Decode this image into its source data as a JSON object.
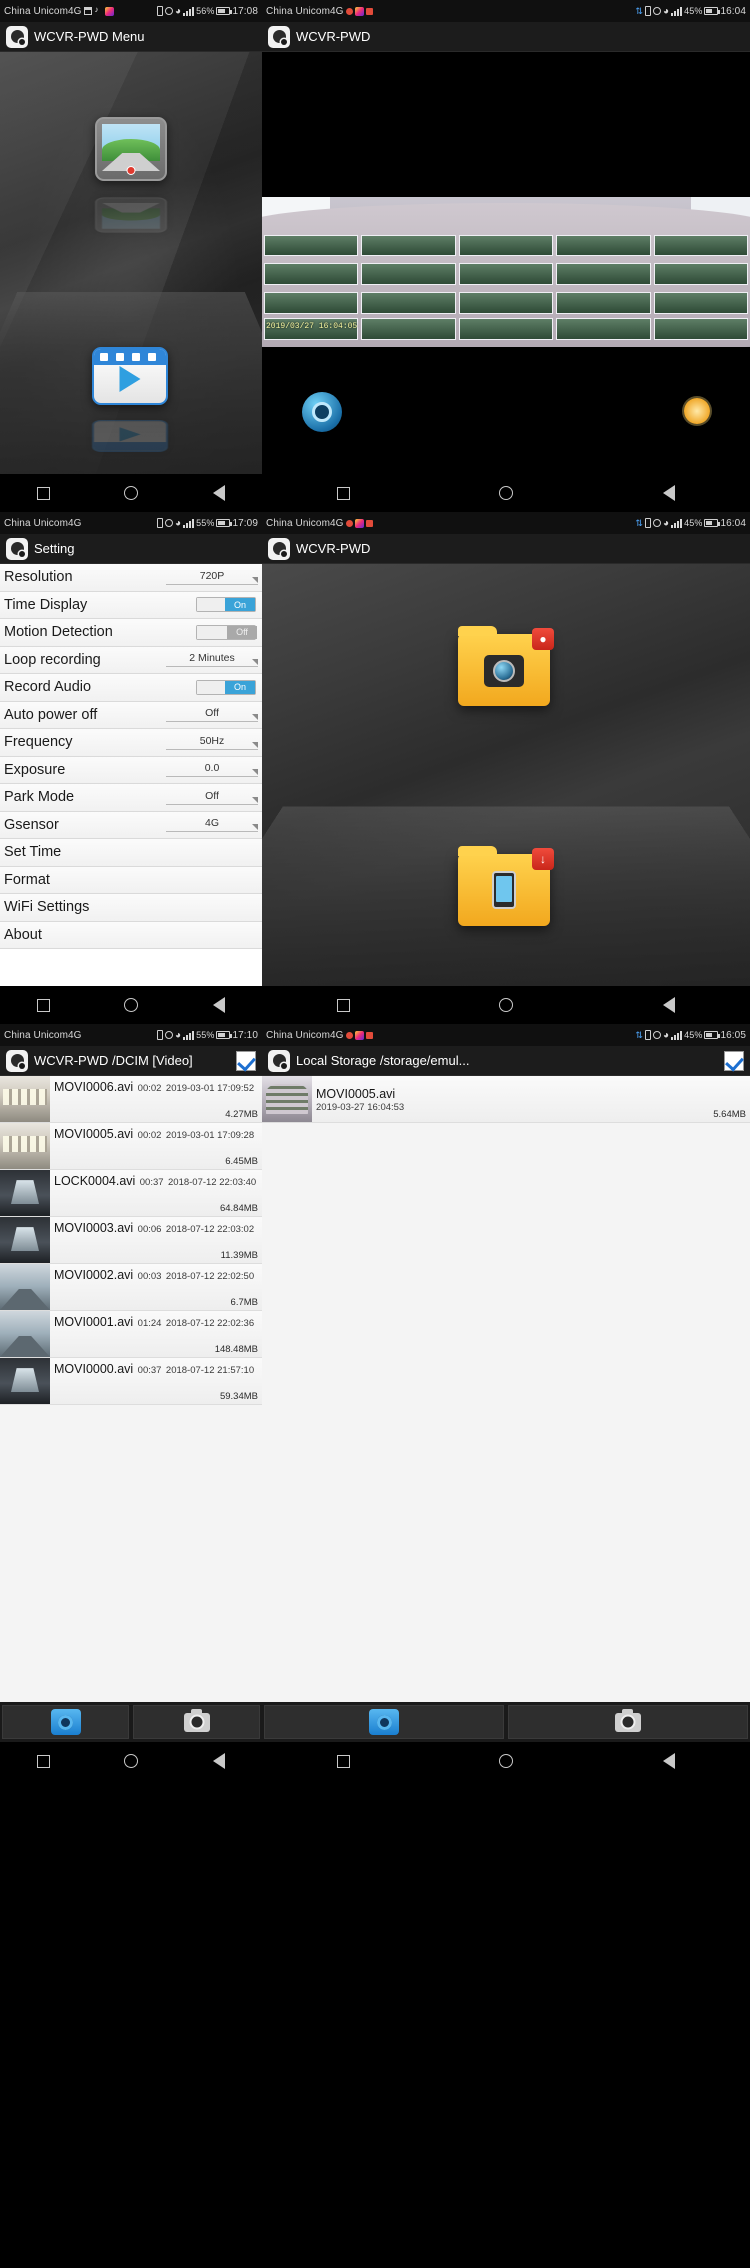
{
  "panels": {
    "p1": {
      "status": {
        "carrier": "China Unicom4G",
        "battery": "56%",
        "time": "17:08"
      },
      "title": "WCVR-PWD Menu",
      "icons": [
        "gallery-icon",
        "video-icon"
      ]
    },
    "p2": {
      "status": {
        "carrier": "China Unicom4G",
        "battery": "45%",
        "time": "16:04"
      },
      "title": "WCVR-PWD",
      "preview_timestamp": "2019/03/27 16:04:05"
    },
    "p3": {
      "status": {
        "carrier": "China Unicom4G",
        "battery": "55%",
        "time": "17:09"
      },
      "title": "Setting",
      "settings": [
        {
          "label": "Resolution",
          "value": "720P",
          "type": "select"
        },
        {
          "label": "Time Display",
          "value": "On",
          "type": "toggle"
        },
        {
          "label": "Motion Detection",
          "value": "Off",
          "type": "toggle"
        },
        {
          "label": "Loop recording",
          "value": "2 Minutes",
          "type": "select"
        },
        {
          "label": "Record Audio",
          "value": "On",
          "type": "toggle"
        },
        {
          "label": "Auto power off",
          "value": "Off",
          "type": "select"
        },
        {
          "label": "Frequency",
          "value": "50Hz",
          "type": "select"
        },
        {
          "label": "Exposure",
          "value": "0.0",
          "type": "select"
        },
        {
          "label": "Park Mode",
          "value": "Off",
          "type": "select"
        },
        {
          "label": "Gsensor",
          "value": "4G",
          "type": "select"
        },
        {
          "label": "Set Time",
          "value": "",
          "type": "plain"
        },
        {
          "label": "Format",
          "value": "",
          "type": "plain"
        },
        {
          "label": "WiFi Settings",
          "value": "",
          "type": "plain"
        },
        {
          "label": "About",
          "value": "",
          "type": "plain"
        }
      ]
    },
    "p4": {
      "status": {
        "carrier": "China Unicom4G",
        "battery": "45%",
        "time": "16:04"
      },
      "title": "WCVR-PWD",
      "folders": [
        "camera-folder",
        "phone-folder"
      ]
    },
    "p5": {
      "status": {
        "carrier": "China Unicom4G",
        "battery": "55%",
        "time": "17:10"
      },
      "title": "WCVR-PWD /DCIM [Video]",
      "files": [
        {
          "name": "MOVI0006.avi",
          "duration": "00:02",
          "date": "2019-03-01 17:09:52",
          "size": "4.27MB",
          "thumb": "office"
        },
        {
          "name": "MOVI0005.avi",
          "duration": "00:02",
          "date": "2019-03-01 17:09:28",
          "size": "6.45MB",
          "thumb": "office"
        },
        {
          "name": "LOCK0004.avi",
          "duration": "00:37",
          "date": "2018-07-12 22:03:40",
          "size": "64.84MB",
          "thumb": "tunnel"
        },
        {
          "name": "MOVI0003.avi",
          "duration": "00:06",
          "date": "2018-07-12 22:03:02",
          "size": "11.39MB",
          "thumb": "tunnel"
        },
        {
          "name": "MOVI0002.avi",
          "duration": "00:03",
          "date": "2018-07-12 22:02:50",
          "size": "6.7MB",
          "thumb": "road"
        },
        {
          "name": "MOVI0001.avi",
          "duration": "01:24",
          "date": "2018-07-12 22:02:36",
          "size": "148.48MB",
          "thumb": "road"
        },
        {
          "name": "MOVI0000.avi",
          "duration": "00:37",
          "date": "2018-07-12 21:57:10",
          "size": "59.34MB",
          "thumb": "tunnel"
        }
      ]
    },
    "p6": {
      "status": {
        "carrier": "China Unicom4G",
        "battery": "45%",
        "time": "16:05"
      },
      "title": "Local Storage /storage/emul...",
      "files": [
        {
          "name": "MOVI0005.avi",
          "duration": "",
          "date": "2019-03-27 16:04:53",
          "size": "5.64MB",
          "thumb": "bldg2"
        }
      ]
    }
  },
  "toolbar": {
    "video_label": "video-icon",
    "camera_label": "camera-icon"
  },
  "navbar": {
    "recents": "recents-icon",
    "home": "home-icon",
    "back": "back-icon"
  },
  "colors": {
    "accent": "#2f86d8",
    "toggle_on": "#3aa3d8",
    "folder": "#f2a81e",
    "badge": "#c9261a"
  }
}
